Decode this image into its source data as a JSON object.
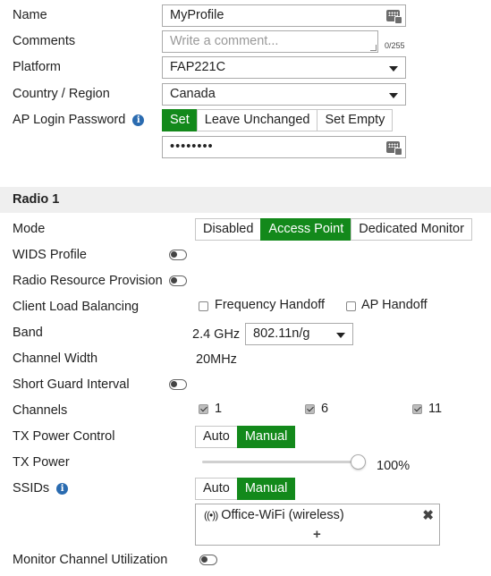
{
  "form": {
    "name": {
      "label": "Name",
      "value": "MyProfile"
    },
    "comments": {
      "label": "Comments",
      "placeholder": "Write a comment...",
      "counter": "0/255"
    },
    "platform": {
      "label": "Platform",
      "value": "FAP221C"
    },
    "country": {
      "label": "Country / Region",
      "value": "Canada"
    },
    "password": {
      "label": "AP Login Password",
      "options": [
        "Set",
        "Leave Unchanged",
        "Set Empty"
      ],
      "selected": "Set",
      "value": "••••••••"
    }
  },
  "radio1": {
    "header": "Radio 1",
    "mode": {
      "label": "Mode",
      "options": [
        "Disabled",
        "Access Point",
        "Dedicated Monitor"
      ],
      "selected": "Access Point"
    },
    "wids": {
      "label": "WIDS Profile",
      "enabled": false
    },
    "rrp": {
      "label": "Radio Resource Provision",
      "enabled": false
    },
    "clb": {
      "label": "Client Load Balancing",
      "freq": "Frequency Handoff",
      "ap": "AP Handoff",
      "freq_checked": false,
      "ap_checked": false
    },
    "band": {
      "label": "Band",
      "freq": "2.4 GHz",
      "value": "802.11n/g"
    },
    "channel_width": {
      "label": "Channel Width",
      "value": "20MHz"
    },
    "sgi": {
      "label": "Short Guard Interval",
      "enabled": false
    },
    "channels": {
      "label": "Channels",
      "items": [
        "1",
        "6",
        "11"
      ]
    },
    "tx_control": {
      "label": "TX Power Control",
      "options": [
        "Auto",
        "Manual"
      ],
      "selected": "Manual"
    },
    "tx_power": {
      "label": "TX Power",
      "value": "100%",
      "level": 1.0
    },
    "ssids": {
      "label": "SSIDs",
      "options": [
        "Auto",
        "Manual"
      ],
      "selected": "Manual",
      "item": "Office-WiFi (wireless)",
      "add": "+"
    },
    "mcu": {
      "label": "Monitor Channel Utilization",
      "enabled": false
    }
  },
  "colors": {
    "accent": "#13891b",
    "info": "#2a6bb0",
    "section_bg": "#efefef"
  }
}
